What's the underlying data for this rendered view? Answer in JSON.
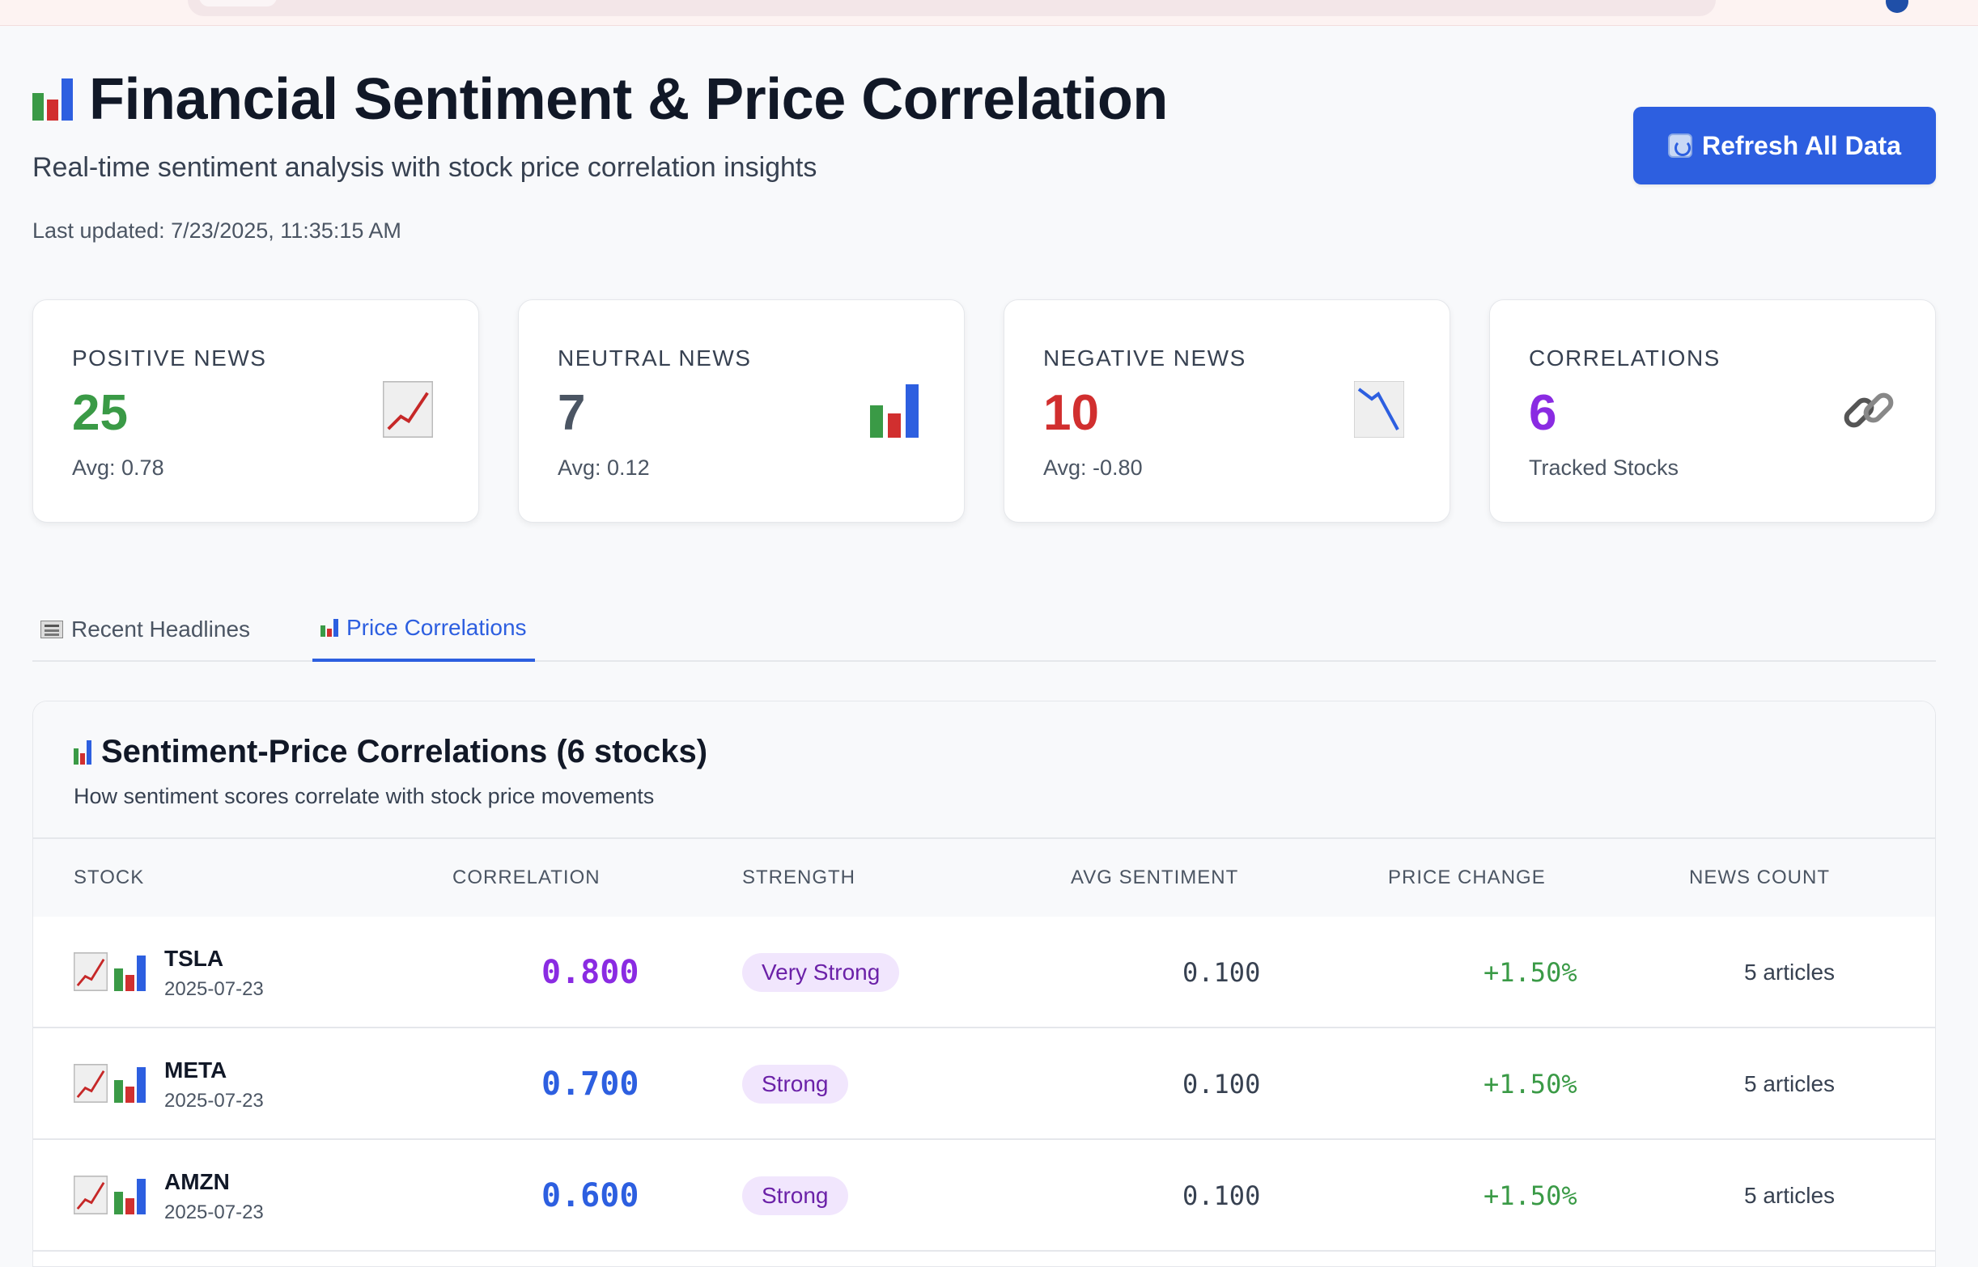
{
  "header": {
    "title": "Financial Sentiment & Price Correlation",
    "title_icon": "bar-chart-icon",
    "subtitle": "Real-time sentiment analysis with stock price correlation insights",
    "last_updated": "Last updated: 7/23/2025, 11:35:15 AM",
    "refresh_label": "Refresh All Data"
  },
  "colors": {
    "accent": "#2d5fe0",
    "positive": "#3a9a46",
    "neutral": "#4b5563",
    "negative": "#d12f2f",
    "correlations": "#8a2be2",
    "badge_bg": "#f1e6fd",
    "badge_text": "#6b21a8"
  },
  "stats": [
    {
      "label": "POSITIVE NEWS",
      "value": "25",
      "sub": "Avg: 0.78",
      "icon": "chart-increasing-icon"
    },
    {
      "label": "NEUTRAL NEWS",
      "value": "7",
      "sub": "Avg: 0.12",
      "icon": "bar-chart-icon"
    },
    {
      "label": "NEGATIVE NEWS",
      "value": "10",
      "sub": "Avg: -0.80",
      "icon": "chart-decreasing-icon"
    },
    {
      "label": "CORRELATIONS",
      "value": "6",
      "sub": "Tracked Stocks",
      "icon": "link-icon"
    }
  ],
  "tabs": [
    {
      "label": "Recent Headlines",
      "icon": "newspaper-icon",
      "active": false
    },
    {
      "label": "Price Correlations",
      "icon": "bar-chart-icon",
      "active": true
    }
  ],
  "correlations_panel": {
    "title": "Sentiment-Price Correlations (6 stocks)",
    "subtitle": "How sentiment scores correlate with stock price movements",
    "columns": [
      "STOCK",
      "CORRELATION",
      "STRENGTH",
      "AVG SENTIMENT",
      "PRICE CHANGE",
      "NEWS COUNT"
    ],
    "rows": [
      {
        "ticker": "TSLA",
        "date": "2025-07-23",
        "correlation": "0.800",
        "strength": "Very Strong",
        "avg_sentiment": "0.100",
        "price_change": "+1.50%",
        "news_count": "5 articles",
        "corr_color": "#8a2be2"
      },
      {
        "ticker": "META",
        "date": "2025-07-23",
        "correlation": "0.700",
        "strength": "Strong",
        "avg_sentiment": "0.100",
        "price_change": "+1.50%",
        "news_count": "5 articles",
        "corr_color": "#2d5fe0"
      },
      {
        "ticker": "AMZN",
        "date": "2025-07-23",
        "correlation": "0.600",
        "strength": "Strong",
        "avg_sentiment": "0.100",
        "price_change": "+1.50%",
        "news_count": "5 articles",
        "corr_color": "#2d5fe0"
      }
    ]
  }
}
